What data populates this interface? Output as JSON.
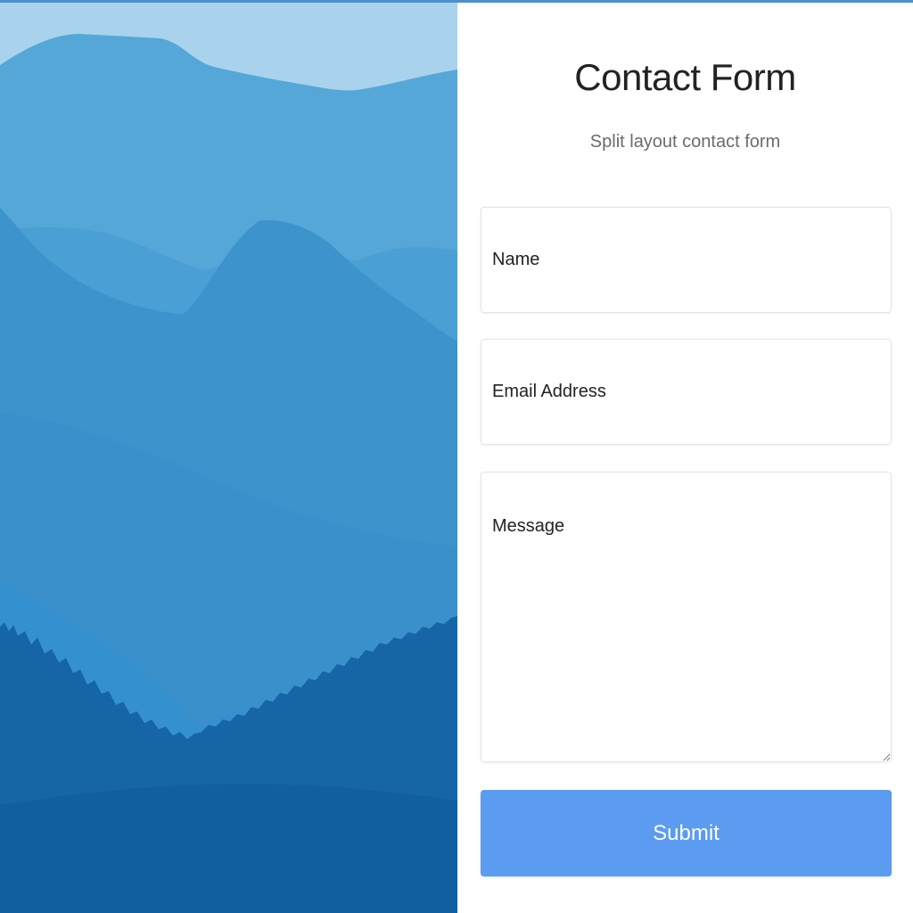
{
  "form": {
    "title": "Contact Form",
    "subtitle": "Split layout contact form",
    "name_placeholder": "Name",
    "email_placeholder": "Email Address",
    "message_placeholder": "Message",
    "submit_label": "Submit"
  },
  "colors": {
    "sky": "#a9d3ec",
    "mountain_far": "#55a7d8",
    "mountain_mid": "#3f97cf",
    "mountain_near": "#2a7fc0",
    "forest": "#1565a7",
    "submit_button": "#5b9bf0"
  }
}
